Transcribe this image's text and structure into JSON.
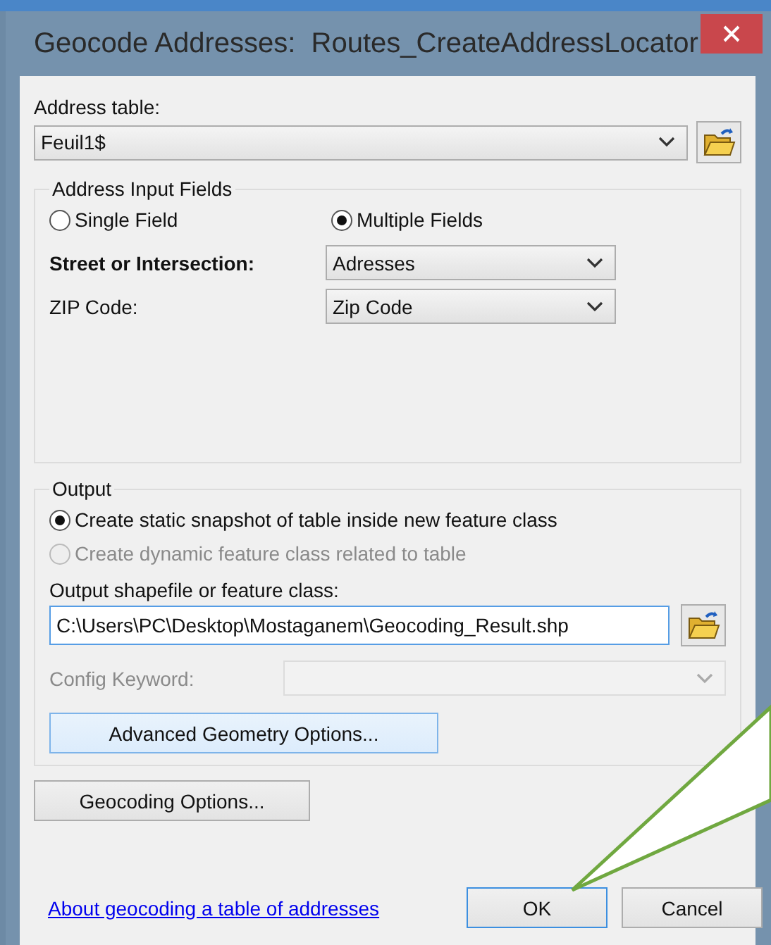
{
  "window": {
    "title": "Geocode Addresses:  Routes_CreateAddressLocator"
  },
  "address_table": {
    "label": "Address table:",
    "value": "Feuil1$"
  },
  "address_input_fields": {
    "title": "Address Input Fields",
    "options": [
      {
        "label": "Single Field",
        "selected": false
      },
      {
        "label": "Multiple Fields",
        "selected": true
      }
    ],
    "fields": [
      {
        "label": "Street or Intersection:",
        "value": "Adresses",
        "required": true
      },
      {
        "label": "ZIP Code:",
        "value": "Zip Code",
        "required": false
      }
    ]
  },
  "output": {
    "title": "Output",
    "options": [
      {
        "label": "Create static snapshot of table inside new feature class",
        "selected": true,
        "disabled": false
      },
      {
        "label": "Create dynamic feature class related to table",
        "selected": false,
        "disabled": true
      }
    ],
    "path_label": "Output shapefile or feature class:",
    "path_value": "C:\\Users\\PC\\Desktop\\Mostaganem\\Geocoding_Result.shp",
    "config_label": "Config Keyword:",
    "config_disabled": true,
    "advanced_button": {
      "label": "Advanced Geometry Options...",
      "highlighted": true
    }
  },
  "geocoding_options_button": "Geocoding Options...",
  "help_link": "About geocoding a table of addresses",
  "buttons": [
    {
      "label": "OK",
      "focused": true
    },
    {
      "label": "Cancel",
      "focused": false
    }
  ]
}
